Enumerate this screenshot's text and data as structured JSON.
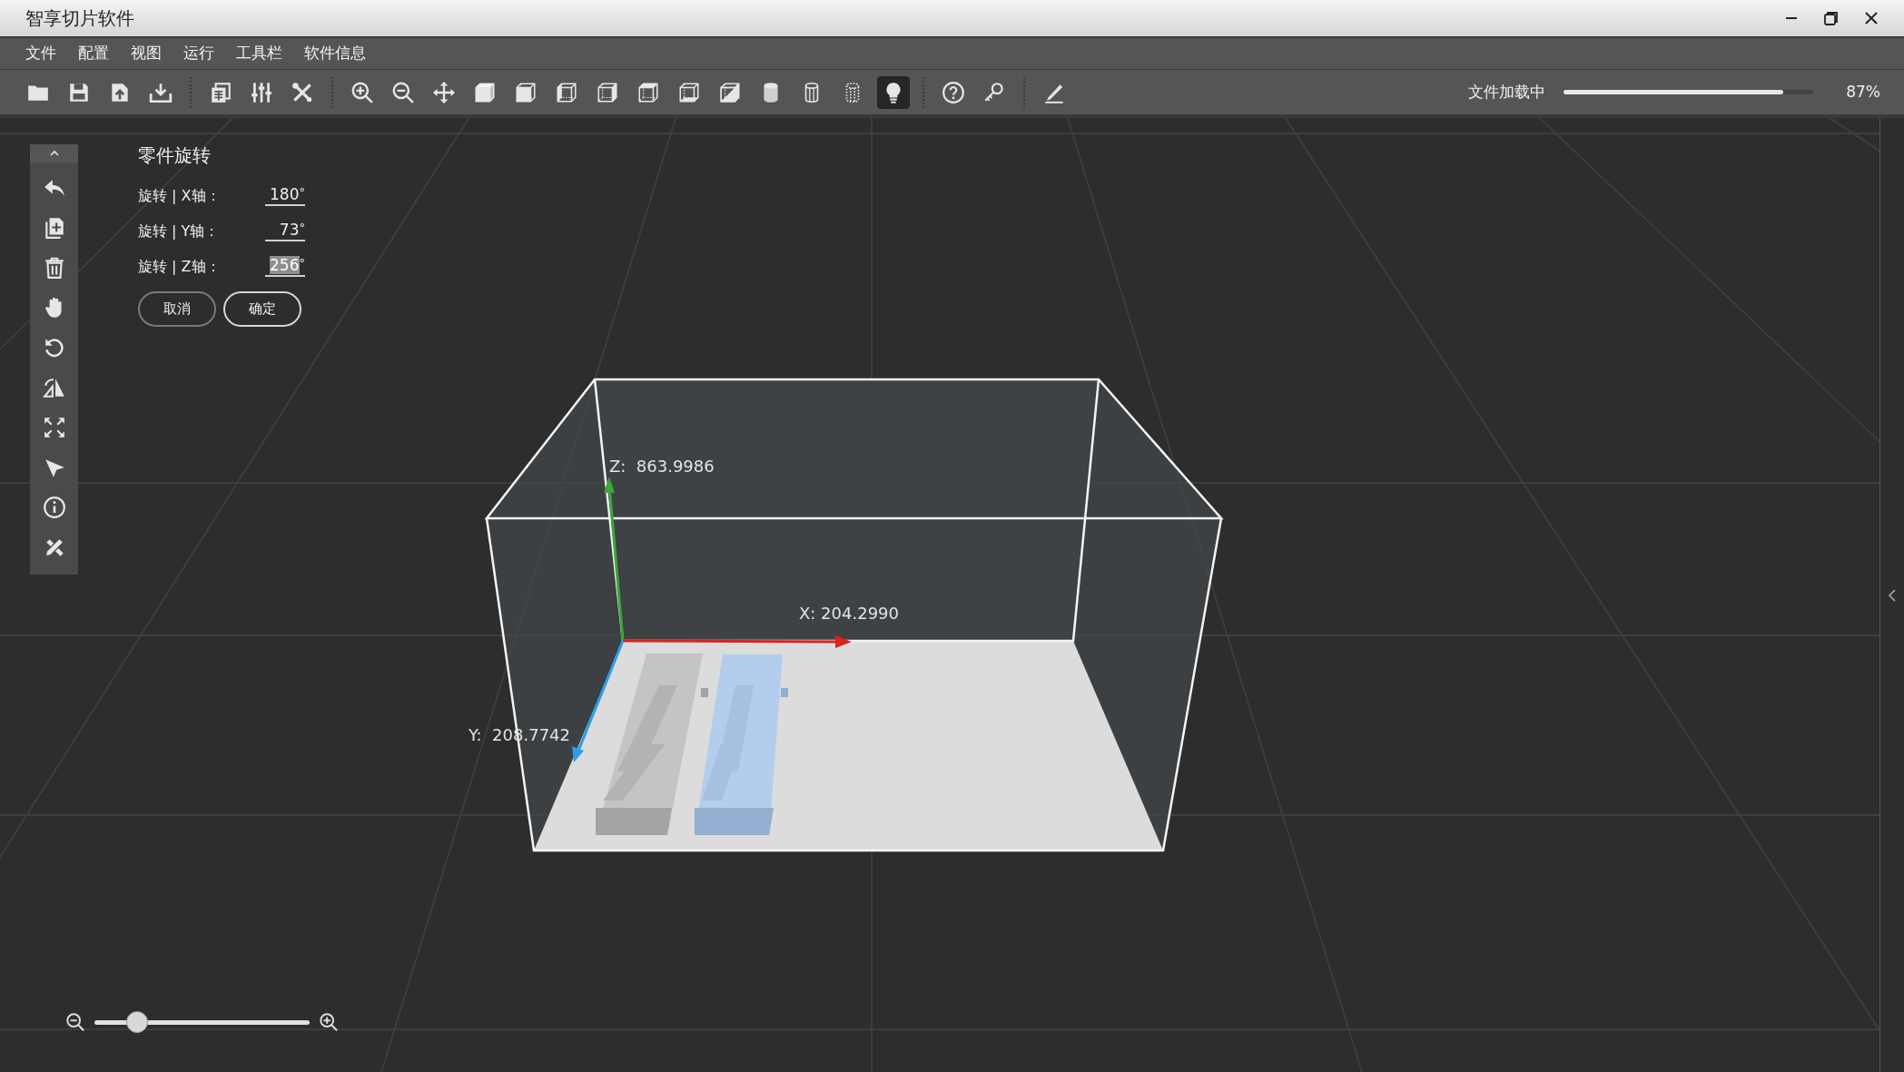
{
  "window": {
    "title": "智享切片软件"
  },
  "menu": [
    {
      "label": "文件"
    },
    {
      "label": "配置"
    },
    {
      "label": "视图"
    },
    {
      "label": "运行"
    },
    {
      "label": "工具栏"
    },
    {
      "label": "软件信息"
    }
  ],
  "toolbar": {
    "groups": [
      [
        {
          "kind": "folder",
          "selected": false
        },
        {
          "kind": "save",
          "selected": false
        },
        {
          "kind": "upload",
          "selected": false
        },
        {
          "kind": "download",
          "selected": false
        }
      ],
      [
        {
          "kind": "document",
          "selected": false
        },
        {
          "kind": "sliders",
          "selected": false
        },
        {
          "kind": "tools",
          "selected": false
        }
      ],
      [
        {
          "kind": "zoom-in",
          "selected": false
        },
        {
          "kind": "zoom-out",
          "selected": false
        },
        {
          "kind": "move",
          "selected": false
        },
        {
          "kind": "cube",
          "selected": false
        },
        {
          "kind": "cube-front",
          "selected": false
        },
        {
          "kind": "cube-left",
          "selected": false
        },
        {
          "kind": "cube-right",
          "selected": false
        },
        {
          "kind": "cube-top",
          "selected": false
        },
        {
          "kind": "cube-bottom",
          "selected": false
        },
        {
          "kind": "half-cube",
          "selected": false
        },
        {
          "kind": "cylinder",
          "selected": false
        },
        {
          "kind": "cylinder-wire",
          "selected": false
        },
        {
          "kind": "cylinder-dotted",
          "selected": false
        },
        {
          "kind": "lightbulb",
          "selected": true
        }
      ],
      [
        {
          "kind": "help",
          "selected": false
        },
        {
          "kind": "key",
          "selected": false
        }
      ],
      [
        {
          "kind": "pen",
          "selected": false
        }
      ]
    ],
    "loading": {
      "label": "文件加载中",
      "level": 0.88,
      "reading": "87%"
    }
  },
  "side_tools": [
    {
      "kind": "chevron-up"
    },
    {
      "kind": "undo"
    },
    {
      "kind": "copy"
    },
    {
      "kind": "trash"
    },
    {
      "kind": "hand"
    },
    {
      "kind": "rotate"
    },
    {
      "kind": "mirror"
    },
    {
      "kind": "scale"
    },
    {
      "kind": "pointer"
    },
    {
      "kind": "info"
    },
    {
      "kind": "ruler-pencil"
    }
  ],
  "rotation": {
    "title": "零件旋转",
    "fields": [
      {
        "label": "旋转 | X轴：",
        "value": "180",
        "unit": "°",
        "selected": false
      },
      {
        "label": "旋转 | Y轴：",
        "value": "73",
        "unit": "°",
        "selected": false
      },
      {
        "label": "旋转 | Z轴：",
        "value": "256",
        "unit": "°",
        "selected": true
      }
    ],
    "buttons": [
      {
        "label": "取消",
        "emphasized": false
      },
      {
        "label": "确定",
        "emphasized": true
      }
    ]
  },
  "scene": {
    "axes": [
      {
        "kind": "z",
        "label": "Z:  863.9986"
      },
      {
        "kind": "x",
        "label": "X: 204.2990"
      },
      {
        "kind": "y",
        "label": "Y:  208.7742"
      }
    ],
    "parts": [
      {
        "selected": false
      },
      {
        "selected": true
      }
    ]
  },
  "zoom": {
    "level": 0.2
  }
}
